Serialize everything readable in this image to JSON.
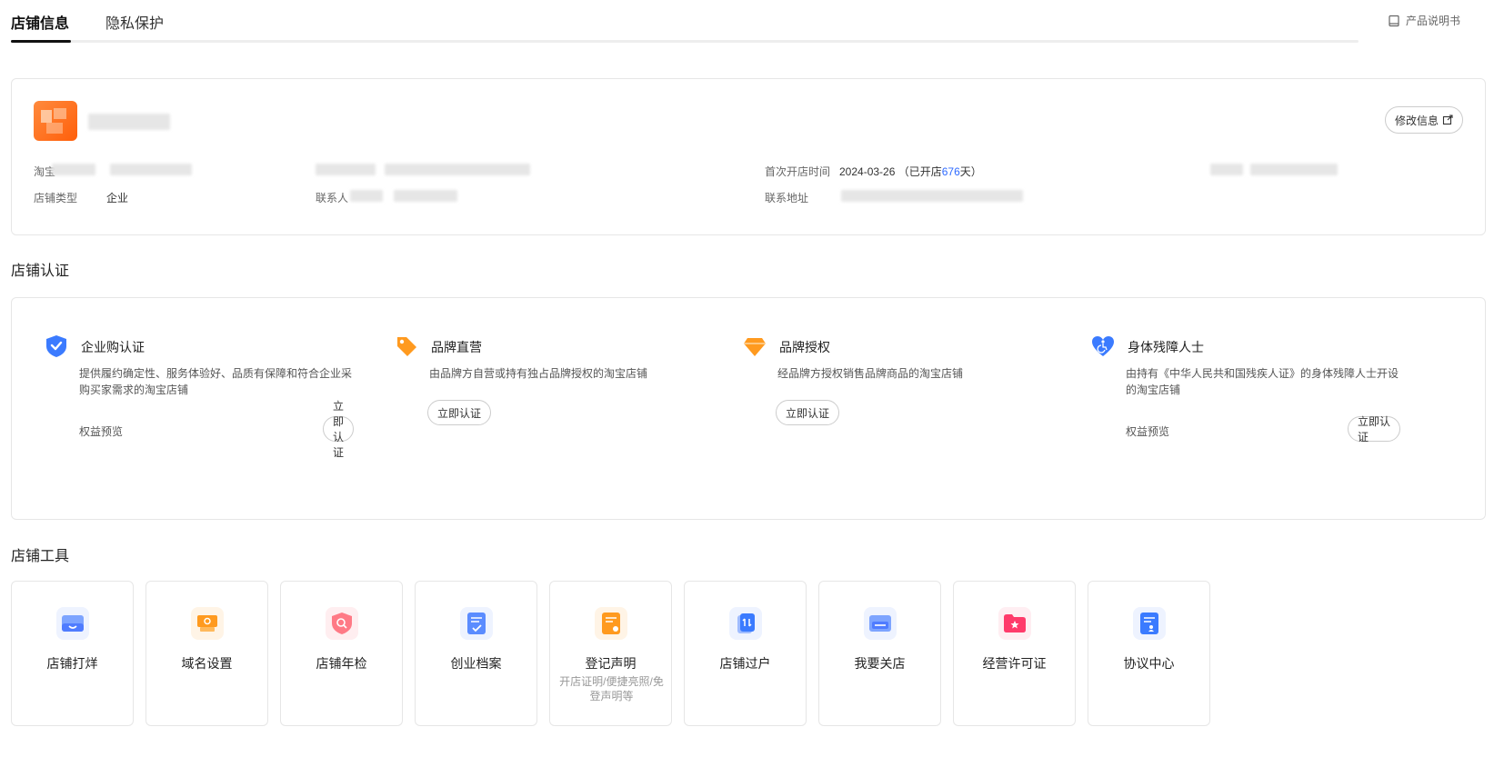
{
  "tabs": [
    {
      "label": "店铺信息",
      "active": true
    },
    {
      "label": "隐私保护",
      "active": false
    }
  ],
  "manual_link": "产品说明书",
  "shop_info": {
    "edit_button": "修改信息",
    "fields": {
      "shop_id_label": "淘宝",
      "shop_type_label": "店铺类型",
      "shop_type_value": "企业",
      "contact_label": "联系人",
      "first_open_label": "首次开店时间",
      "first_open_date": "2024-03-26",
      "open_prefix": "（已开店",
      "open_days": "676",
      "open_suffix": "天）",
      "address_label": "联系地址"
    }
  },
  "certification": {
    "title": "店铺认证",
    "items": [
      {
        "name": "企业购认证",
        "desc": "提供履约确定性、服务体验好、品质有保障和符合企业采购买家需求的淘宝店铺",
        "benefit": "权益预览",
        "button": "立即认证",
        "icon": "shield-check-icon",
        "color": "#3b7bff"
      },
      {
        "name": "品牌直营",
        "desc": "由品牌方自营或持有独占品牌授权的淘宝店铺",
        "benefit": "",
        "button": "立即认证",
        "icon": "tag-icon",
        "color": "#ff9a1f"
      },
      {
        "name": "品牌授权",
        "desc": "经品牌方授权销售品牌商品的淘宝店铺",
        "benefit": "",
        "button": "立即认证",
        "icon": "diamond-icon",
        "color": "#ff9a1f"
      },
      {
        "name": "身体残障人士",
        "desc": "由持有《中华人民共和国残疾人证》的身体残障人士开设的淘宝店铺",
        "benefit": "权益预览",
        "button": "立即认证",
        "icon": "accessibility-heart-icon",
        "color": "#3b7bff"
      }
    ]
  },
  "tools": {
    "title": "店铺工具",
    "items": [
      {
        "name": "店铺打烊",
        "sub": "",
        "icon": "store-close-icon",
        "color": "#5b8cff"
      },
      {
        "name": "域名设置",
        "sub": "",
        "icon": "domain-settings-icon",
        "color": "#ff9a1f"
      },
      {
        "name": "店铺年检",
        "sub": "",
        "icon": "annual-inspection-icon",
        "color": "#ff6b6b"
      },
      {
        "name": "创业档案",
        "sub": "",
        "icon": "archive-icon",
        "color": "#5b8cff"
      },
      {
        "name": "登记声明",
        "sub": "开店证明/便捷亮照/免登声明等",
        "icon": "registration-icon",
        "color": "#ff9a1f"
      },
      {
        "name": "店铺过户",
        "sub": "",
        "icon": "transfer-icon",
        "color": "#3b7bff"
      },
      {
        "name": "我要关店",
        "sub": "",
        "icon": "close-store-icon",
        "color": "#5b8cff"
      },
      {
        "name": "经营许可证",
        "sub": "",
        "icon": "license-folder-icon",
        "color": "#ff3b6b"
      },
      {
        "name": "协议中心",
        "sub": "",
        "icon": "agreement-icon",
        "color": "#3b7bff"
      }
    ]
  }
}
